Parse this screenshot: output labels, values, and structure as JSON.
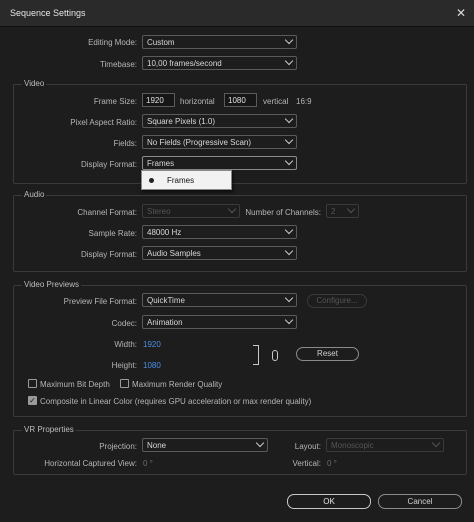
{
  "window": {
    "title": "Sequence Settings",
    "close_glyph": "✕"
  },
  "top": {
    "editing_mode_label": "Editing Mode:",
    "editing_mode_value": "Custom",
    "timebase_label": "Timebase:",
    "timebase_value": "10,00  frames/second"
  },
  "video": {
    "group_title": "Video",
    "frame_size_label": "Frame Size:",
    "frame_width": "1920",
    "horizontal_label": "horizontal",
    "frame_height": "1080",
    "vertical_label": "vertical",
    "aspect_ratio": "16:9",
    "pixel_aspect_label": "Pixel Aspect Ratio:",
    "pixel_aspect_value": "Square Pixels (1.0)",
    "fields_label": "Fields:",
    "fields_value": "No Fields (Progressive Scan)",
    "display_format_label": "Display Format:",
    "display_format_value": "Frames",
    "display_format_options": [
      "Frames"
    ]
  },
  "audio": {
    "group_title": "Audio",
    "channel_format_label": "Channel Format:",
    "channel_format_value": "Stereo",
    "num_channels_label": "Number of Channels:",
    "num_channels_value": "2",
    "sample_rate_label": "Sample Rate:",
    "sample_rate_value": "48000 Hz",
    "display_format_label": "Display Format:",
    "display_format_value": "Audio Samples"
  },
  "previews": {
    "group_title": "Video Previews",
    "file_format_label": "Preview File Format:",
    "file_format_value": "QuickTime",
    "configure_label": "Configure...",
    "codec_label": "Codec:",
    "codec_value": "Animation",
    "width_label": "Width:",
    "width_value": "1920",
    "height_label": "Height:",
    "height_value": "1080",
    "reset_label": "Reset",
    "max_bit_depth_label": "Maximum Bit Depth",
    "max_render_quality_label": "Maximum Render Quality",
    "composite_label": "Composite in Linear Color (requires GPU acceleration or max render quality)"
  },
  "vr": {
    "group_title": "VR Properties",
    "projection_label": "Projection:",
    "projection_value": "None",
    "layout_label": "Layout:",
    "layout_value": "Monoscopic",
    "h_captured_label": "Horizontal Captured View:",
    "h_captured_value": "0 °",
    "vertical_label": "Vertical:",
    "vertical_value": "0 °"
  },
  "footer": {
    "ok_label": "OK",
    "cancel_label": "Cancel"
  },
  "colors": {
    "background": "#1d1d1d",
    "link": "#4a8fe7",
    "dropdown_bg": "#f2f2f2"
  }
}
